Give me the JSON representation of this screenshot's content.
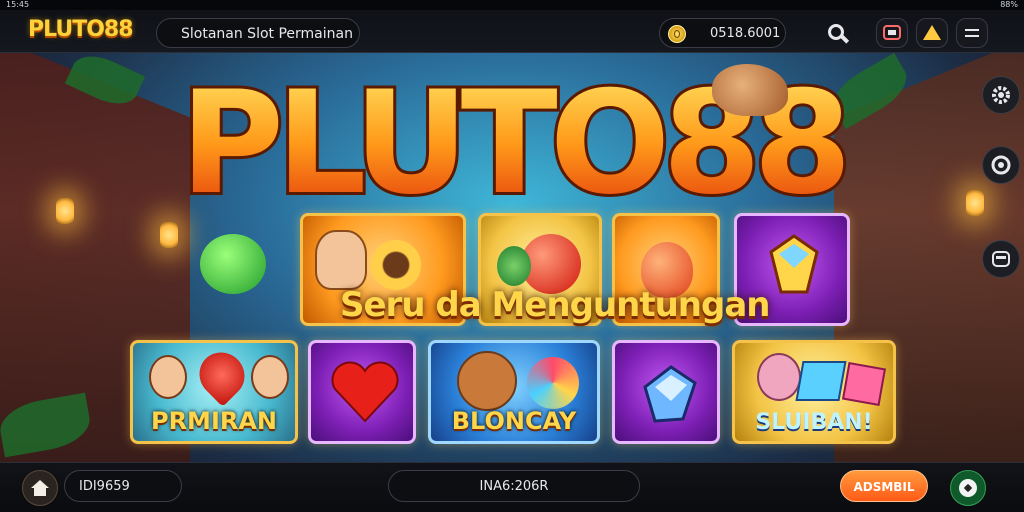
{
  "status_bar": {
    "left": "15:45",
    "right": "88%"
  },
  "header": {
    "logo": "PLUTO88",
    "search_text": "Slotanan Slot Permainan",
    "balance": "0518.6001"
  },
  "banner": {
    "title": "PLUTO88",
    "tagline": "Seru da Menguntungan"
  },
  "game_tiles": [
    {
      "label": ""
    },
    {
      "label": ""
    },
    {
      "label": ""
    },
    {
      "label": ""
    },
    {
      "label": "PRMIRAN"
    },
    {
      "label": ""
    },
    {
      "label": "BLONCAY"
    },
    {
      "label": ""
    },
    {
      "label": "SLUIBAN!"
    }
  ],
  "footer": {
    "left_value": "IDI9659",
    "center_value": "INA6:206R",
    "cta_label": "ADSMBIL"
  },
  "colors": {
    "accent_gold": "#ffd54a",
    "cta_orange": "#ff5a17",
    "bar_dark": "#0d0e12"
  }
}
